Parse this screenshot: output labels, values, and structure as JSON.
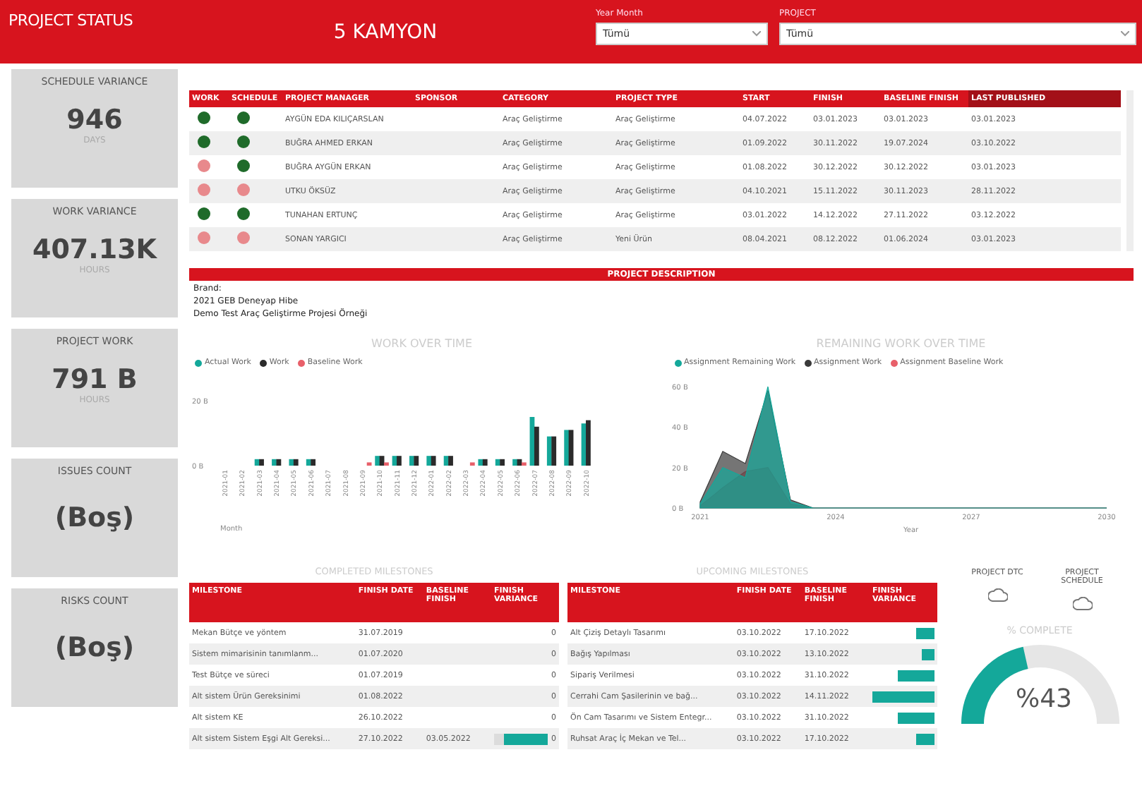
{
  "header": {
    "title": "PROJECT STATUS",
    "project_name": "5 KAMYON",
    "filters": [
      {
        "label": "Year Month",
        "value": "Tümü"
      },
      {
        "label": "PROJECT",
        "value": "Tümü"
      }
    ]
  },
  "kpis": [
    {
      "title": "SCHEDULE VARIANCE",
      "value": "946",
      "unit": "DAYS"
    },
    {
      "title": "WORK VARIANCE",
      "value": "407.13K",
      "unit": "HOURS"
    },
    {
      "title": "PROJECT WORK",
      "value": "791 B",
      "unit": "HOURS"
    },
    {
      "title": "ISSUES COUNT",
      "value": "(Boş)"
    },
    {
      "title": "RISKS COUNT",
      "value": "(Boş)"
    }
  ],
  "projects_table": {
    "columns": [
      "WORK",
      "SCHEDULE",
      "PROJECT MANAGER",
      "SPONSOR",
      "CATEGORY",
      "PROJECT TYPE",
      "START",
      "FINISH",
      "BASELINE FINISH",
      "LAST PUBLISHED"
    ],
    "rows": [
      {
        "work_on_track": true,
        "schedule_on_track": true,
        "manager": "AYGÜN EDA KILIÇARSLAN",
        "category": "Araç Geliştirme",
        "type": "Araç Geliştirme",
        "start": "04.07.2022",
        "finish": "03.01.2023",
        "baseline_finish": "03.01.2023",
        "last_published": "03.01.2023"
      },
      {
        "work_on_track": true,
        "schedule_on_track": true,
        "manager": "BUĞRA AHMED ERKAN",
        "category": "Araç Geliştirme",
        "type": "Araç Geliştirme",
        "start": "01.09.2022",
        "finish": "30.11.2022",
        "baseline_finish": "19.07.2024",
        "last_published": "03.10.2022"
      },
      {
        "work_on_track": false,
        "schedule_on_track": true,
        "manager": "BUĞRA AYGÜN ERKAN",
        "category": "Araç Geliştirme",
        "type": "Araç Geliştirme",
        "start": "01.08.2022",
        "finish": "30.12.2022",
        "baseline_finish": "30.12.2022",
        "last_published": "03.01.2023"
      },
      {
        "work_on_track": false,
        "schedule_on_track": false,
        "manager": "UTKU ÖKSÜZ",
        "category": "Araç Geliştirme",
        "type": "Araç Geliştirme",
        "start": "04.10.2021",
        "finish": "15.11.2022",
        "baseline_finish": "30.11.2023",
        "last_published": "28.11.2022"
      },
      {
        "work_on_track": true,
        "schedule_on_track": true,
        "manager": "TUNAHAN ERTUNÇ",
        "category": "Araç Geliştirme",
        "type": "Araç Geliştirme",
        "start": "03.01.2022",
        "finish": "14.12.2022",
        "baseline_finish": "27.11.2022",
        "last_published": "03.12.2022"
      },
      {
        "work_on_track": false,
        "schedule_on_track": false,
        "manager": "SONAN YARGICI",
        "category": "Araç Geliştirme",
        "type": "Yeni Ürün",
        "start": "08.04.2021",
        "finish": "08.12.2022",
        "baseline_finish": "01.06.2024",
        "last_published": "03.01.2023"
      }
    ]
  },
  "description": {
    "title": "PROJECT DESCRIPTION",
    "lines": [
      "Brand:",
      "2021 GEB Deneyap Hibe",
      "Demo Test Araç Geliştirme Projesi Örneği"
    ]
  },
  "work_chart": {
    "chart_data": {
      "type": "bar",
      "title": "WORK OVER TIME",
      "xlabel": "Month",
      "categories": [
        "2021-01",
        "2021-02",
        "2021-03",
        "2021-04",
        "2021-05",
        "2021-06",
        "2021-07",
        "2021-08",
        "2021-09",
        "2021-10",
        "2021-11",
        "2021-12",
        "2022-01",
        "2022-02",
        "2022-03",
        "2022-04",
        "2022-05",
        "2022-06",
        "2022-07",
        "2022-08",
        "2022-09",
        "2022-10"
      ],
      "series": [
        {
          "name": "Actual Work",
          "color": "#14a89a",
          "values": [
            0,
            0,
            2,
            2,
            2,
            2,
            0,
            0,
            0,
            3,
            3,
            3,
            3,
            3,
            0,
            2,
            2,
            2,
            15,
            9,
            11,
            13
          ]
        },
        {
          "name": "Work",
          "color": "#2b2b2b",
          "values": [
            0,
            0,
            2,
            2,
            2,
            2,
            0,
            0,
            0,
            3,
            3,
            3,
            3,
            3,
            0,
            2,
            2,
            2,
            12,
            9,
            11,
            14
          ]
        },
        {
          "name": "Baseline Work",
          "color": "#e8606a",
          "values": [
            0,
            0,
            0,
            0,
            0,
            0,
            0,
            0,
            1,
            1,
            0,
            0,
            0,
            0,
            1,
            0,
            0,
            1,
            0,
            0,
            0,
            0
          ]
        }
      ],
      "yticks": [
        {
          "value": 0,
          "label": "0 B"
        },
        {
          "value": 20,
          "label": "20 B"
        }
      ],
      "ylim": [
        0,
        20
      ]
    }
  },
  "remaining_chart": {
    "chart_data": {
      "type": "area",
      "title": "REMAINING WORK OVER TIME",
      "xlabel": "Year",
      "x": [
        2021,
        2021.5,
        2022,
        2022.5,
        2023,
        2023.5,
        2024,
        2025,
        2026,
        2027,
        2028,
        2029,
        2030
      ],
      "series": [
        {
          "name": "Assignment Remaining Work",
          "color": "#14a89a",
          "values": [
            2,
            20,
            15,
            60,
            3,
            0,
            0,
            0,
            0,
            0,
            0,
            0,
            0
          ]
        },
        {
          "name": "Assignment Work",
          "color": "#3a3a3a",
          "values": [
            3,
            28,
            22,
            58,
            4,
            0,
            0,
            0,
            0,
            0,
            0,
            0,
            0
          ]
        },
        {
          "name": "Assignment Baseline Work",
          "color": "#e8606a",
          "values": [
            1,
            10,
            18,
            20,
            2,
            0,
            0,
            0,
            0,
            0,
            0,
            0,
            0
          ]
        }
      ],
      "xticks": [
        {
          "value": 2021,
          "label": "2021"
        },
        {
          "value": 2024,
          "label": "2024"
        },
        {
          "value": 2027,
          "label": "2027"
        },
        {
          "value": 2030,
          "label": "2030"
        }
      ],
      "xlim": [
        2021,
        2030
      ],
      "yticks": [
        {
          "value": 0,
          "label": "0 B"
        },
        {
          "value": 20,
          "label": "20 B"
        },
        {
          "value": 40,
          "label": "40 B"
        },
        {
          "value": 60,
          "label": "60 B"
        }
      ],
      "ylim": [
        0,
        60
      ]
    }
  },
  "milestone_tables": [
    {
      "title": "COMPLETED MILESTONES",
      "columns": [
        "MILESTONE",
        "FINISH DATE",
        "BASELINE FINISH",
        "FINISH VARIANCE"
      ],
      "rows": [
        {
          "name": "Mekan Bütçe ve yöntem",
          "finish": "31.07.2019",
          "variance": "0"
        },
        {
          "name": "Sistem mimarisinin tanımlanm...",
          "finish": "01.07.2020",
          "variance": "0"
        },
        {
          "name": "Test Bütçe ve süreci",
          "finish": "01.07.2019",
          "variance": "0"
        },
        {
          "name": "Alt sistem Ürün Gereksinimi",
          "finish": "01.08.2022",
          "variance": "0"
        },
        {
          "name": "Alt sistem KE",
          "finish": "26.10.2022",
          "variance": "0"
        },
        {
          "name": "Alt sistem Sistem Eşgi Alt Gereksi...",
          "finish": "27.10.2022",
          "baseline": "03.05.2022",
          "variance": "0",
          "level": 0.8
        }
      ]
    },
    {
      "title": "UPCOMING MILESTONES",
      "columns": [
        "MILESTONE",
        "FINISH DATE",
        "BASELINE FINISH",
        "FINISH VARIANCE"
      ],
      "rows": [
        {
          "name": "Alt Çiziş Detaylı Tasarımı",
          "finish": "03.10.2022",
          "baseline": "17.10.2022",
          "level": 0.3
        },
        {
          "name": "Bağış Yapılması",
          "finish": "03.10.2022",
          "baseline": "13.10.2022",
          "level": 0.2
        },
        {
          "name": "Sipariş Verilmesi",
          "finish": "03.10.2022",
          "baseline": "31.10.2022",
          "level": 0.6
        },
        {
          "name": "Cerrahi Cam Şasilerinin ve bağ...",
          "finish": "03.10.2022",
          "baseline": "14.11.2022",
          "level": 1
        },
        {
          "name": "Ön Cam Tasarımı ve Sistem Entegr...",
          "finish": "03.10.2022",
          "baseline": "31.10.2022",
          "level": 0.6
        },
        {
          "name": "Ruhsat Araç İç Mekan ve Tel...",
          "finish": "03.10.2022",
          "baseline": "17.10.2022",
          "level": 0.3
        }
      ]
    }
  ],
  "health": [
    {
      "label": "PROJECT DTC"
    },
    {
      "label": "PROJECT SCHEDULE"
    }
  ],
  "gauge": {
    "title": "% COMPLETE",
    "value": "%43",
    "level": 0.43
  }
}
